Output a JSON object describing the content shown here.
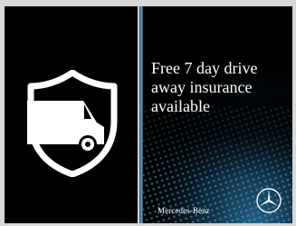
{
  "ad": {
    "headline_lines": [
      "Free 7 day drive",
      "away insurance",
      "available"
    ],
    "brand": "Mercedes-Benz"
  },
  "icons": {
    "shield": "shield-van-icon",
    "logo": "mercedes-star-icon"
  },
  "colors": {
    "background": "#000000",
    "accent": "#2f7fb0",
    "text": "#ffffff"
  }
}
